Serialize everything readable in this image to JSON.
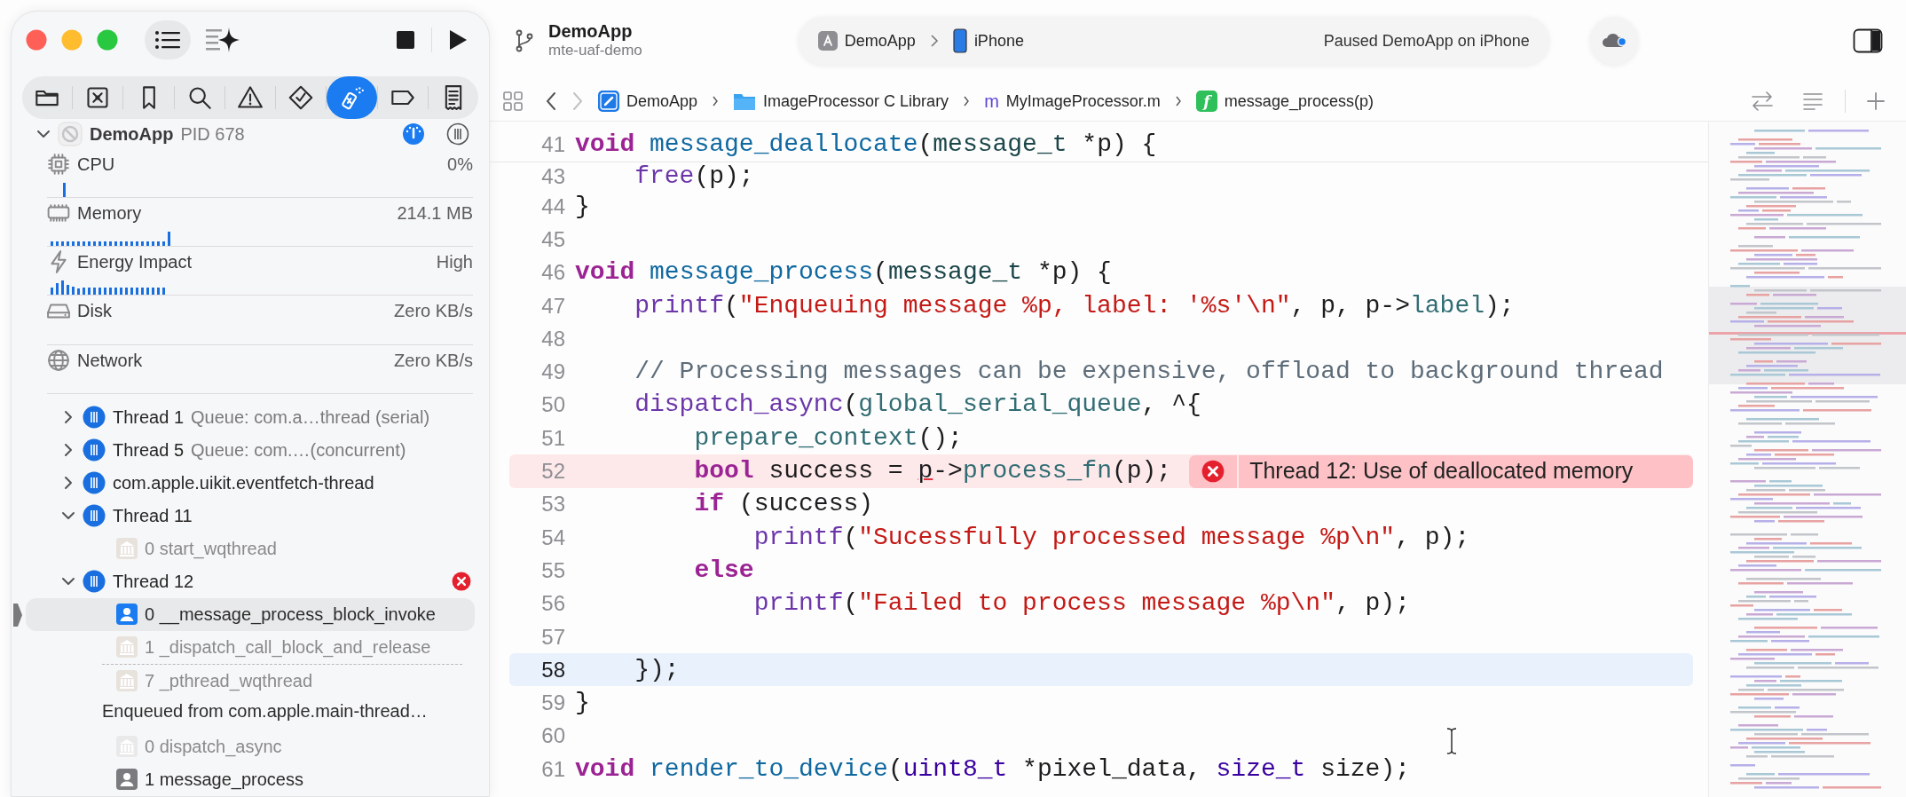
{
  "sidebar": {
    "navigator_tabs": [
      {
        "selected": false
      },
      {
        "selected": false
      },
      {
        "selected": false
      },
      {
        "selected": false
      },
      {
        "selected": false
      },
      {
        "selected": false
      },
      {
        "selected": true
      },
      {
        "selected": false
      },
      {
        "selected": false
      }
    ],
    "process": {
      "name": "DemoApp",
      "pid": "PID 678",
      "expanded": true
    },
    "gauges": [
      {
        "name": "CPU",
        "value": "0%",
        "kind": "spike"
      },
      {
        "name": "Memory",
        "value": "214.1 MB",
        "kind": "steady"
      },
      {
        "name": "Energy Impact",
        "value": "High",
        "kind": "bursty"
      },
      {
        "name": "Disk",
        "value": "Zero KB/s",
        "kind": "plain"
      },
      {
        "name": "Network",
        "value": "Zero KB/s",
        "kind": "plain"
      }
    ],
    "threads": [
      {
        "name": "Thread 1",
        "detail": "Queue: com.a…thread (serial)",
        "expanded": false,
        "error": false
      },
      {
        "name": "Thread 5",
        "detail": "Queue: com.…(concurrent)",
        "expanded": false,
        "error": false
      },
      {
        "name": "com.apple.uikit.eventfetch-thread",
        "expanded": false,
        "error": false
      },
      {
        "name": "Thread 11",
        "expanded": true,
        "error": false,
        "frames": [
          {
            "label": "0 start_wqthread",
            "kind": "system",
            "dimmed": false,
            "selected": false,
            "gap_after": false
          }
        ]
      },
      {
        "name": "Thread 12",
        "expanded": true,
        "error": true,
        "frames": [
          {
            "label": "0 __message_process_block_invoke",
            "kind": "user",
            "dimmed": false,
            "selected": true,
            "gap_after": false
          },
          {
            "label": "1 _dispatch_call_block_and_release",
            "kind": "system",
            "dimmed": false,
            "selected": false,
            "gap_after": true
          },
          {
            "label": "7 _pthread_wqthread",
            "kind": "system",
            "dimmed": false,
            "selected": false,
            "gap_after": false
          }
        ],
        "enqueued": {
          "label": "Enqueued from com.apple.main-thread…",
          "frames": [
            {
              "label": "0 dispatch_async",
              "kind": "system",
              "dimmed": true,
              "selected": false,
              "gap_after": false
            },
            {
              "label": "1 message_process",
              "kind": "user",
              "dimmed": true,
              "selected": false,
              "gap_after": false
            }
          ]
        }
      }
    ]
  },
  "editor": {
    "toolbar": {
      "title": "DemoApp",
      "subtitle": "mte-uaf-demo",
      "scheme": "DemoApp",
      "device": "iPhone",
      "status": "Paused DemoApp on iPhone"
    },
    "breadcrumbs": [
      {
        "kind": "project",
        "label": "DemoApp"
      },
      {
        "kind": "folder",
        "label": "ImageProcessor C Library"
      },
      {
        "kind": "source",
        "glyph": "m",
        "label": "MyImageProcessor.m"
      },
      {
        "kind": "function",
        "glyph": "f",
        "label": "message_process(p)"
      }
    ],
    "code": {
      "sticky_line": {
        "number": "41",
        "tokens": [
          {
            "kind": "keyword",
            "text": "void"
          },
          {
            "kind": "decl",
            "text": " message_deallocate"
          },
          {
            "kind": "plain",
            "text": "("
          },
          {
            "kind": "type",
            "text": "message_t"
          },
          {
            "kind": "plain",
            "text": " *p) {"
          }
        ]
      },
      "lines": [
        {
          "number": "43",
          "kind": "plain",
          "tokens": [
            {
              "kind": "sysfunc",
              "text": "    free"
            },
            {
              "kind": "plain",
              "text": "(p);"
            }
          ]
        },
        {
          "number": "44",
          "kind": "plain",
          "tokens": [
            {
              "kind": "plain",
              "text": "}"
            }
          ]
        },
        {
          "number": "45",
          "kind": "plain"
        },
        {
          "number": "46",
          "kind": "plain",
          "tokens": [
            {
              "kind": "keyword",
              "text": "void"
            },
            {
              "kind": "decl",
              "text": " message_process"
            },
            {
              "kind": "plain",
              "text": "("
            },
            {
              "kind": "type",
              "text": "message_t"
            },
            {
              "kind": "plain",
              "text": " *p) {"
            }
          ]
        },
        {
          "number": "47",
          "kind": "plain",
          "tokens": [
            {
              "kind": "sysfunc",
              "text": "    printf"
            },
            {
              "kind": "plain",
              "text": "("
            },
            {
              "kind": "string",
              "text": "\"Enqueuing message %p, label: '%s'\\n\""
            },
            {
              "kind": "plain",
              "text": ", p, p->"
            },
            {
              "kind": "project",
              "text": "label"
            },
            {
              "kind": "plain",
              "text": ");"
            }
          ]
        },
        {
          "number": "48",
          "kind": "plain"
        },
        {
          "number": "49",
          "kind": "plain",
          "tokens": [
            {
              "kind": "comment",
              "text": "    // Processing messages can be expensive, offload to background thread"
            }
          ]
        },
        {
          "number": "50",
          "kind": "plain",
          "tokens": [
            {
              "kind": "sysfunc",
              "text": "    dispatch_async"
            },
            {
              "kind": "plain",
              "text": "("
            },
            {
              "kind": "project",
              "text": "global_serial_queue"
            },
            {
              "kind": "plain",
              "text": ", ^{"
            }
          ]
        },
        {
          "number": "51",
          "kind": "plain",
          "tokens": [
            {
              "kind": "project",
              "text": "        prepare_context"
            },
            {
              "kind": "plain",
              "text": "();"
            }
          ]
        },
        {
          "number": "52",
          "kind": "error",
          "tokens": [
            {
              "kind": "keyword",
              "text": "        bool"
            },
            {
              "kind": "plain",
              "text": " success = "
            },
            {
              "kind": "flagged",
              "text": "p"
            },
            {
              "kind": "plain",
              "text": "->"
            },
            {
              "kind": "project",
              "text": "process_fn"
            },
            {
              "kind": "plain",
              "text": "(p);"
            }
          ],
          "issue": "Thread 12: Use of deallocated memory"
        },
        {
          "number": "53",
          "kind": "plain",
          "tokens": [
            {
              "kind": "keyword",
              "text": "        if"
            },
            {
              "kind": "plain",
              "text": " (success)"
            }
          ]
        },
        {
          "number": "54",
          "kind": "plain",
          "tokens": [
            {
              "kind": "sysfunc",
              "text": "            printf"
            },
            {
              "kind": "plain",
              "text": "("
            },
            {
              "kind": "string",
              "text": "\"Sucessfully processed message %p\\n\""
            },
            {
              "kind": "plain",
              "text": ", p);"
            }
          ]
        },
        {
          "number": "55",
          "kind": "plain",
          "tokens": [
            {
              "kind": "keyword",
              "text": "        else"
            }
          ]
        },
        {
          "number": "56",
          "kind": "plain",
          "tokens": [
            {
              "kind": "sysfunc",
              "text": "            printf"
            },
            {
              "kind": "plain",
              "text": "("
            },
            {
              "kind": "string",
              "text": "\"Failed to process message %p\\n\""
            },
            {
              "kind": "plain",
              "text": ", p);"
            }
          ]
        },
        {
          "number": "57",
          "kind": "plain"
        },
        {
          "number": "58",
          "kind": "current",
          "tokens": [
            {
              "kind": "plain",
              "text": "    });"
            }
          ]
        },
        {
          "number": "59",
          "kind": "plain",
          "tokens": [
            {
              "kind": "plain",
              "text": "}"
            }
          ]
        },
        {
          "number": "60",
          "kind": "plain"
        },
        {
          "number": "61",
          "kind": "plain",
          "tokens": [
            {
              "kind": "keyword",
              "text": "void"
            },
            {
              "kind": "decl",
              "text": " render_to_device"
            },
            {
              "kind": "plain",
              "text": "("
            },
            {
              "kind": "systype",
              "text": "uint8_t"
            },
            {
              "kind": "plain",
              "text": " *pixel_data, "
            },
            {
              "kind": "systype",
              "text": "size_t"
            },
            {
              "kind": "plain",
              "text": " size);"
            }
          ]
        }
      ]
    }
  }
}
